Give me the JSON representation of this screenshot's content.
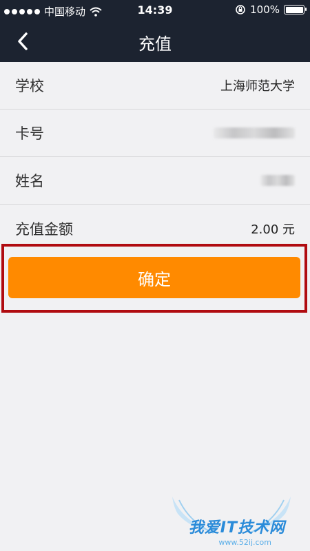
{
  "status_bar": {
    "carrier": "中国移动",
    "time": "14:39",
    "battery_percent": "100%",
    "battery_level": 1.0
  },
  "nav": {
    "title": "充值",
    "back_icon": "chevron-left-icon"
  },
  "form": {
    "rows": [
      {
        "label": "学校",
        "value": "上海师范大学"
      },
      {
        "label": "卡号",
        "value": ""
      },
      {
        "label": "姓名",
        "value": ""
      },
      {
        "label": "充值金额",
        "value": "2.00 元"
      }
    ]
  },
  "confirm_button": {
    "label": "确定"
  },
  "watermark": {
    "text": "我爱IT技术网",
    "url": "www.52ij.com"
  },
  "colors": {
    "header": "#1c2330",
    "accent": "#ff8a00",
    "highlight": "#b00b10",
    "background": "#f1f1f3"
  }
}
